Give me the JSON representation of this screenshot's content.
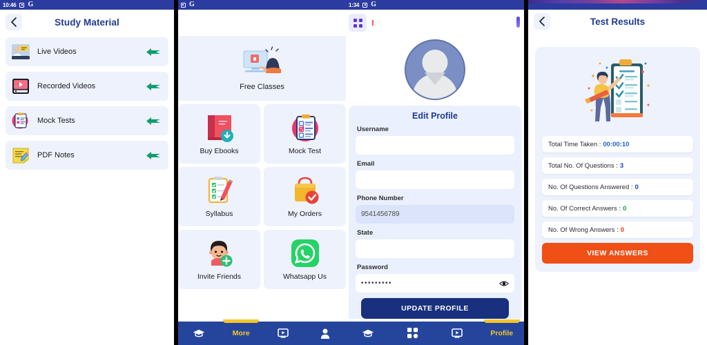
{
  "panels": {
    "study": {
      "status": {
        "time": "10:46",
        "battery_icon": "battery-icon",
        "app_icon": "google-g-icon"
      },
      "header": {
        "back_icon": "back-chevron-icon",
        "title": "Study Material"
      },
      "items": [
        {
          "label": "Live Videos",
          "icon": "live-video-icon",
          "arrow": "arrow-right-icon"
        },
        {
          "label": "Recorded Videos",
          "icon": "recorded-video-icon",
          "arrow": "arrow-right-icon"
        },
        {
          "label": "Mock Tests",
          "icon": "clipboard-test-icon",
          "arrow": "arrow-right-icon"
        },
        {
          "label": "PDF Notes",
          "icon": "pdf-notes-icon",
          "arrow": "arrow-right-icon"
        }
      ]
    },
    "home": {
      "status": {
        "time": "",
        "battery_icon": "battery-icon",
        "app_icon": "google-g-icon"
      },
      "feature": {
        "label": "Free Classes",
        "icon": "free-classes-icon"
      },
      "tiles": [
        {
          "label": "Buy Ebooks",
          "icon": "ebook-download-icon"
        },
        {
          "label": "Mock Test",
          "icon": "mock-test-icon"
        },
        {
          "label": "Syllabus",
          "icon": "syllabus-icon"
        },
        {
          "label": "My Orders",
          "icon": "orders-bag-icon"
        },
        {
          "label": "Invite Friends",
          "icon": "invite-friends-icon"
        },
        {
          "label": "Whatsapp Us",
          "icon": "whatsapp-icon"
        }
      ],
      "nav": [
        {
          "label": "",
          "icon": "graduation-cap-icon",
          "active": false
        },
        {
          "label": "More",
          "icon": "",
          "active": true
        },
        {
          "label": "",
          "icon": "video-screen-icon",
          "active": false
        },
        {
          "label": "",
          "icon": "person-icon",
          "active": false
        }
      ]
    },
    "profile": {
      "status": {
        "time": "1:34",
        "battery_icon": "battery-icon",
        "app_icon": "google-g-icon"
      },
      "toolbar": {
        "grid_icon": "grid-apps-icon"
      },
      "avatar_icon": "default-avatar-icon",
      "card_title": "Edit Profile",
      "fields": [
        {
          "label": "Username",
          "value": "",
          "type": "text",
          "filled": false
        },
        {
          "label": "Email",
          "value": "",
          "type": "email",
          "filled": false
        },
        {
          "label": "Phone Number",
          "value": "9541456789",
          "type": "tel",
          "filled": true
        },
        {
          "label": "State",
          "value": "",
          "type": "text",
          "filled": false
        },
        {
          "label": "Password",
          "value": "•••••••••",
          "type": "password",
          "filled": false,
          "trailing_icon": "eye-icon"
        }
      ],
      "update_button": "UPDATE PROFILE",
      "nav": [
        {
          "label": "",
          "icon": "graduation-cap-icon",
          "active": false
        },
        {
          "label": "",
          "icon": "grid-apps-icon",
          "active": false
        },
        {
          "label": "",
          "icon": "video-screen-icon",
          "active": false
        },
        {
          "label": "Profile",
          "icon": "",
          "active": true
        }
      ]
    },
    "results": {
      "header": {
        "back_icon": "back-chevron-icon",
        "title": "Test Results"
      },
      "illustration_icon": "checklist-person-icon",
      "stats": [
        {
          "label": "Total Time Taken :",
          "value": "00:00:10",
          "color": "#1f5fd0"
        },
        {
          "label": "Total No. Of Questions :",
          "value": "3",
          "color": "#1f3fd0"
        },
        {
          "label": "No. Of Questions Answered :",
          "value": "0",
          "color": "#1f3fd0"
        },
        {
          "label": "No. Of Correct Answers :",
          "value": "0",
          "color": "#17a34a"
        },
        {
          "label": "No. Of Wrong Answers :",
          "value": "0",
          "color": "#ef3b14"
        }
      ],
      "view_button": "VIEW ANSWERS"
    }
  },
  "colors": {
    "brand_blue": "#25459d",
    "title_blue": "#1f3a93",
    "card_bg": "#eef2fd",
    "accent_yellow": "#f6c52a",
    "accent_orange": "#f04f16",
    "arrow_green": "#0f9d6e"
  }
}
